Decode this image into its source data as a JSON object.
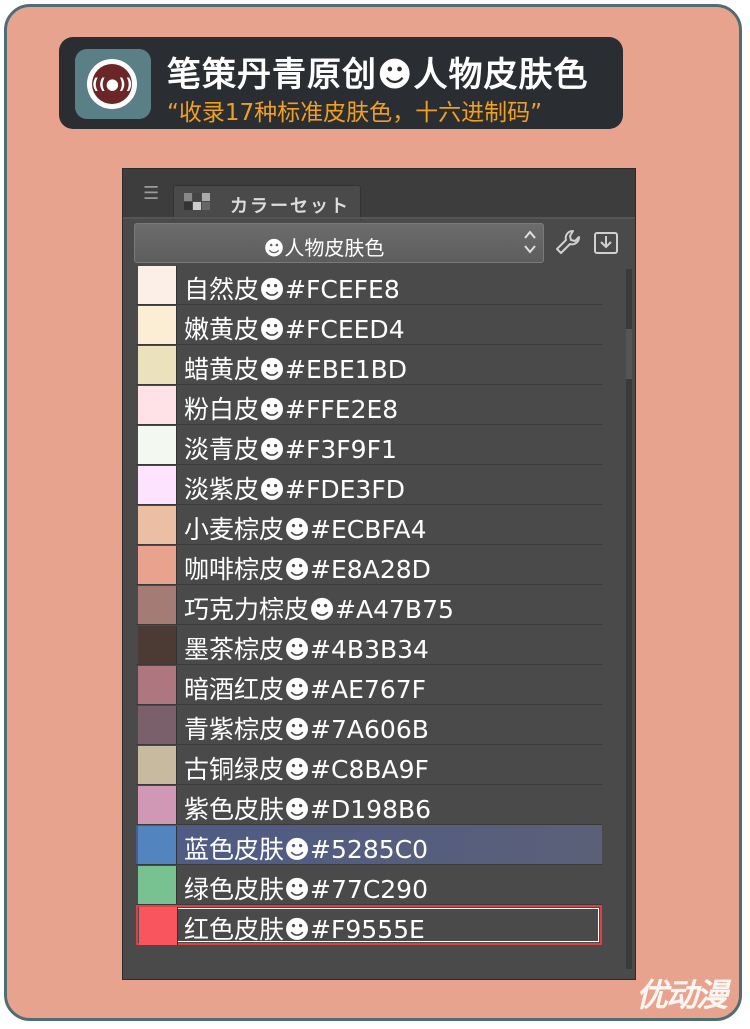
{
  "banner": {
    "title": "笔策丹青原创☻人物皮肤色",
    "subtitle": "“收录17种标准皮肤色，十六进制码”",
    "logo_text": "((●))"
  },
  "panel": {
    "tab_label": "カラーセット",
    "selector_value": "☻人物皮肤色",
    "updown_glyph": "⌃⌄",
    "icons": [
      "menu-icon",
      "color-set-icon",
      "wrench-icon",
      "import-icon",
      "updown-icon"
    ]
  },
  "colors": [
    {
      "label": "自然皮☻#FCEFE8",
      "hex": "#FCEFE8"
    },
    {
      "label": "嫩黄皮☻#FCEED4",
      "hex": "#FCEED4"
    },
    {
      "label": "蜡黄皮☻#EBE1BD",
      "hex": "#EBE1BD"
    },
    {
      "label": "粉白皮☻#FFE2E8",
      "hex": "#FFE2E8"
    },
    {
      "label": "淡青皮☻#F3F9F1",
      "hex": "#F3F9F1"
    },
    {
      "label": "淡紫皮☻#FDE3FD",
      "hex": "#FDE3FD"
    },
    {
      "label": "小麦棕皮☻#ECBFA4",
      "hex": "#ECBFA4"
    },
    {
      "label": "咖啡棕皮☻#E8A28D",
      "hex": "#E8A28D"
    },
    {
      "label": "巧克力棕皮☻#A47B75",
      "hex": "#A47B75"
    },
    {
      "label": "墨茶棕皮☻#4B3B34",
      "hex": "#4B3B34"
    },
    {
      "label": "暗酒红皮☻#AE767F",
      "hex": "#AE767F"
    },
    {
      "label": "青紫棕皮☻#7A606B",
      "hex": "#7A606B"
    },
    {
      "label": "古铜绿皮☻#C8BA9F",
      "hex": "#C8BA9F"
    },
    {
      "label": "紫色皮肤☻#D198B6",
      "hex": "#D198B6"
    },
    {
      "label": "蓝色皮肤☻#5285C0",
      "hex": "#5285C0"
    },
    {
      "label": "绿色皮肤☻#77C290",
      "hex": "#77C290"
    },
    {
      "label": "红色皮肤☻#F9555E",
      "hex": "#F9555E"
    }
  ],
  "selected_index": 14,
  "focused_index": 16,
  "watermark": "优动漫",
  "theme": {
    "background": "#E8A38E",
    "border": "#4F6D73",
    "banner_bg": "#2A2D31",
    "subtitle_color": "#F0A020",
    "panel_bg": "#4A4A4A",
    "selection": "#5B6078",
    "focus_border": "#E04040"
  }
}
